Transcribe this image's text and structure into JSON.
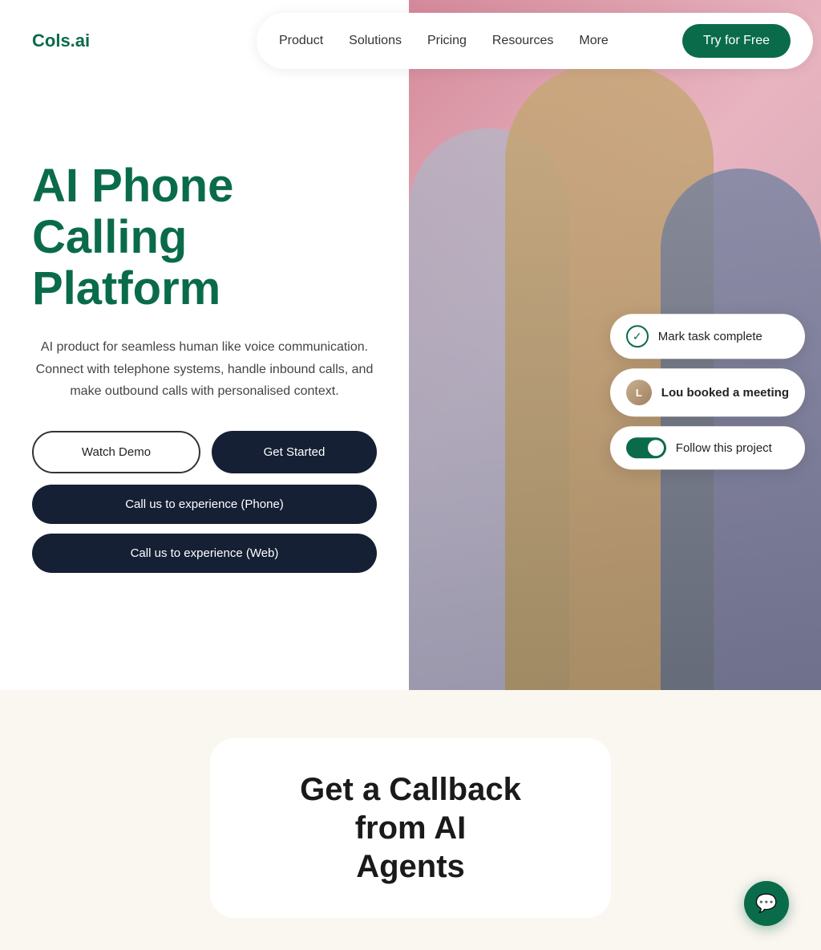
{
  "logo": {
    "text": "Cols.ai"
  },
  "navbar": {
    "links": [
      {
        "id": "product",
        "label": "Product"
      },
      {
        "id": "solutions",
        "label": "Solutions"
      },
      {
        "id": "pricing",
        "label": "Pricing"
      },
      {
        "id": "resources",
        "label": "Resources"
      },
      {
        "id": "more",
        "label": "More"
      }
    ],
    "cta_label": "Try for Free"
  },
  "hero": {
    "title": "AI Phone Calling Platform",
    "subtitle": "AI product for seamless human like voice communication. Connect with telephone systems, handle inbound calls, and make outbound calls with personalised context.",
    "watch_demo_label": "Watch Demo",
    "get_started_label": "Get Started",
    "call_phone_label": "Call us to experience (Phone)",
    "call_web_label": "Call us to experience (Web)"
  },
  "floating_cards": {
    "mark_task": {
      "label": "Mark task complete"
    },
    "booked_meeting": {
      "user": "Lou",
      "action": " booked a meeting"
    },
    "follow_project": {
      "label": "Follow this project"
    }
  },
  "bottom": {
    "callback_title": "Get a Callback from AI",
    "callback_subtitle": "Agents"
  },
  "colors": {
    "brand_green": "#0a6b4b",
    "dark_navy": "#152035",
    "bg_cream": "#faf6f0"
  }
}
